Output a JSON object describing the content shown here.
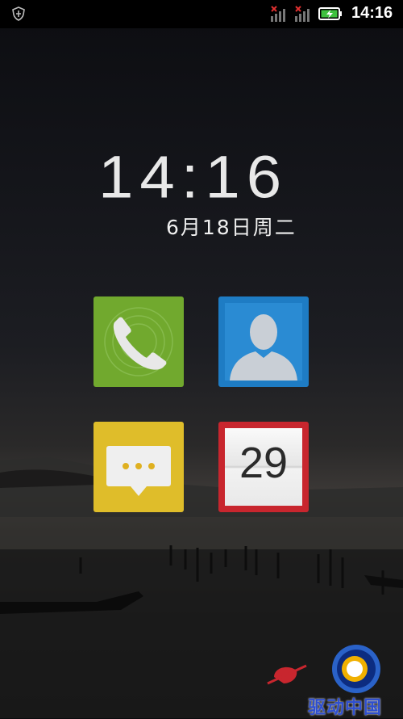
{
  "status_bar": {
    "time": "14:16",
    "icons": [
      "shield-icon",
      "signal-icon",
      "signal-icon",
      "battery-charging-icon"
    ]
  },
  "lock_screen": {
    "clock": "14:16",
    "date": "6月18日周二"
  },
  "tiles": [
    {
      "name": "phone",
      "icon": "phone-icon",
      "color": "#71a92e"
    },
    {
      "name": "contacts",
      "icon": "person-icon",
      "color": "#1e7cc4"
    },
    {
      "name": "messages",
      "icon": "chat-bubble-icon",
      "color": "#dfbd2a"
    },
    {
      "name": "calendar",
      "icon": "calendar-icon",
      "color": "#c8262e",
      "day": "29"
    }
  ],
  "watermark": {
    "text": "驱动中国"
  }
}
